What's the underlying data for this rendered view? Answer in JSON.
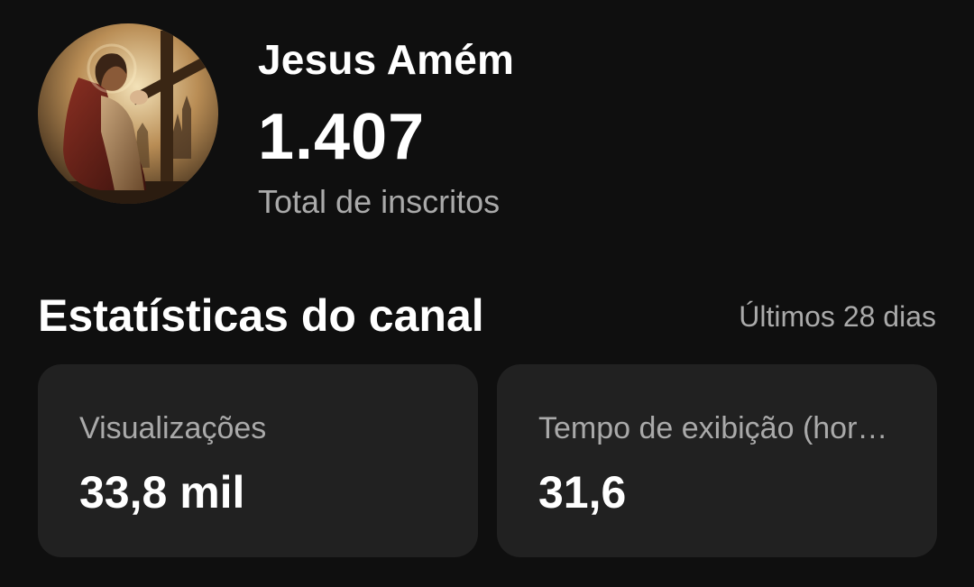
{
  "channel": {
    "name": "Jesus Amém",
    "subscribers": "1.407",
    "subscribers_label": "Total de inscritos",
    "avatar_icon": "praying-figure-avatar"
  },
  "stats": {
    "title": "Estatísticas do canal",
    "period": "Últimos 28 dias",
    "cards": [
      {
        "label": "Visualizações",
        "value": "33,8 mil"
      },
      {
        "label": "Tempo de exibição (horas)",
        "value": "31,6"
      }
    ]
  },
  "colors": {
    "background": "#0f0f0f",
    "card": "#212121",
    "primary_text": "#ffffff",
    "secondary_text": "#aaaaaa"
  }
}
